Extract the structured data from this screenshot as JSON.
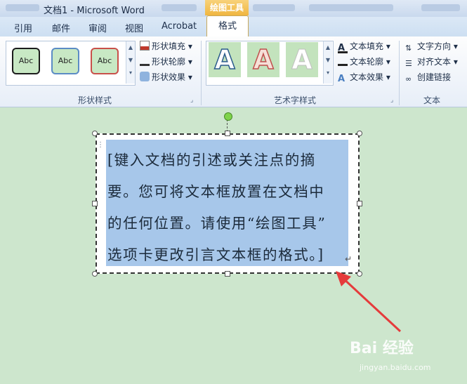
{
  "window": {
    "title": "文档1 - Microsoft Word",
    "contextual_tab": "绘图工具"
  },
  "tabs": [
    "引用",
    "邮件",
    "审阅",
    "视图",
    "Acrobat"
  ],
  "active_tab": "格式",
  "ribbon": {
    "shape_styles": {
      "label": "形状样式",
      "gallery": [
        "Abc",
        "Abc",
        "Abc"
      ],
      "commands": [
        "形状填充",
        "形状轮廓",
        "形状效果"
      ]
    },
    "wordart_styles": {
      "label": "艺术字样式",
      "gallery": [
        "A",
        "A",
        "A"
      ],
      "commands": [
        "文本填充",
        "文本轮廓",
        "文本效果"
      ]
    },
    "text": {
      "label": "文本",
      "commands": [
        "文字方向",
        "对齐文本",
        "创建链接"
      ]
    }
  },
  "document": {
    "textbox_lines": [
      "[键入文档的引述或关注点的摘",
      "要。您可将文本框放置在文档中",
      "的任何位置。请使用“绘图工具”",
      "选项卡更改引言文本框的格式。]"
    ]
  },
  "watermark": {
    "brand": "Bai 经验",
    "url": "jingyan.baidu.com"
  },
  "colors": {
    "ribbon_tab_accent": "#f0b640",
    "annotation_arrow": "#e53b3b",
    "selection": "#a7c7ea"
  }
}
